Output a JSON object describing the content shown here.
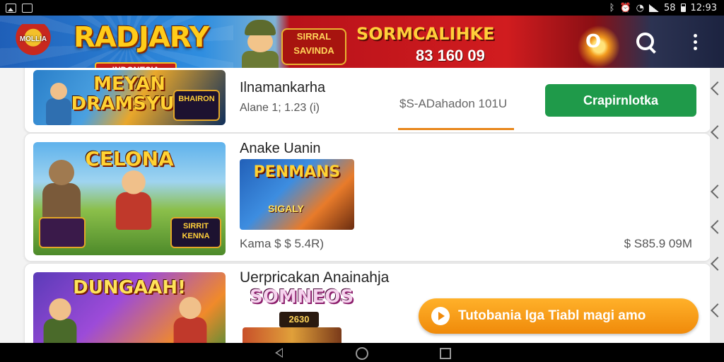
{
  "status_bar": {
    "time": "12:93",
    "battery_text": "58"
  },
  "banner": {
    "small_logo_text": "MOLLIA",
    "game_title": "RADJARY",
    "game_subtitle": "INDONESIA",
    "promo_badge": "SIRRAL SAVINDA",
    "promo_headline": "SORMCALIHKE",
    "promo_number": "83 160 09",
    "button_o_label": "O",
    "icons": [
      "search-icon",
      "more-icon"
    ]
  },
  "list": {
    "items": [
      {
        "thumb_title": "MEYAN DRAMSYUS",
        "thumb_badge": "BHAIRON",
        "name": "Ilnamankarha",
        "meta": "Alane 1; 1.23 (i)",
        "price": "$S-ADahadon 101U",
        "action_label": "Crapirnlotka"
      },
      {
        "thumb_title": "CELONA",
        "thumb_badge": "SIRRIT KENNA",
        "name": "Anake Uanin",
        "small_thumb_title": "PENMANS",
        "small_thumb_sub": "SIGALY",
        "meta": "Kama $ $ 5.4R)",
        "size": "$ S85.9 09M"
      },
      {
        "thumb_title": "DUNGAAH!",
        "name": "Uerpricakan Anainahja",
        "collage_title": "SOMNEOS",
        "collage_sub": "2630"
      }
    ]
  },
  "cta": {
    "label": "Tutobania Iga Tiabl magi amo"
  }
}
